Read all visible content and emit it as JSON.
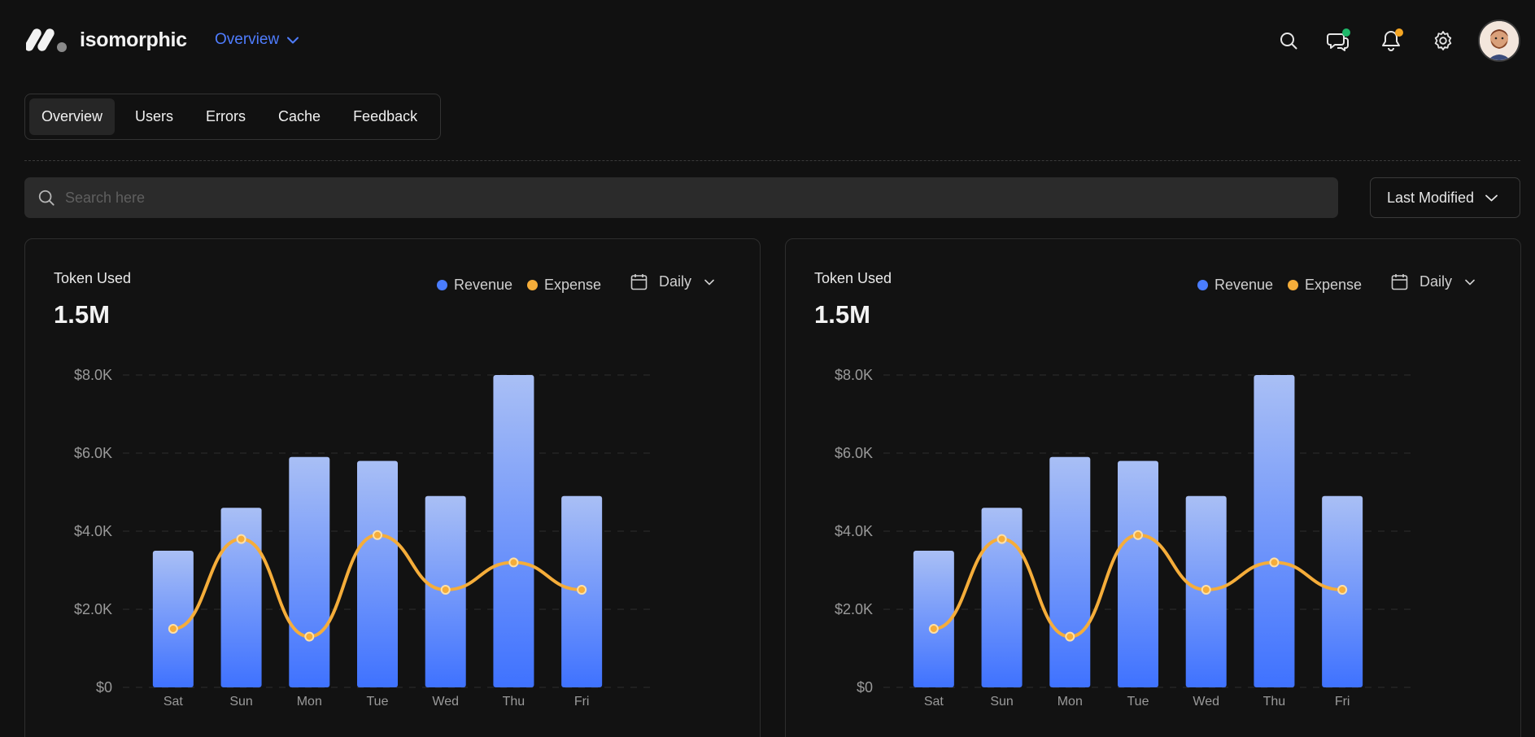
{
  "app": {
    "name": "isomorphic",
    "nav_label": "Overview"
  },
  "header_icons": [
    "search-icon",
    "chat-icon",
    "bell-icon",
    "gear-icon"
  ],
  "colors": {
    "accent": "#4f7dff",
    "revenue": "#4a7dff",
    "expense": "#f5ad3a",
    "chat_dot": "#1fb86a",
    "bell_dot": "#f5a623"
  },
  "tabs": [
    {
      "label": "Overview",
      "active": true
    },
    {
      "label": "Users",
      "active": false
    },
    {
      "label": "Errors",
      "active": false
    },
    {
      "label": "Cache",
      "active": false
    },
    {
      "label": "Feedback",
      "active": false
    }
  ],
  "search": {
    "placeholder": "Search here"
  },
  "sort": {
    "label": "Last Modified"
  },
  "cards": [
    {
      "title": "Token Used",
      "value": "1.5M",
      "legend": {
        "revenue": "Revenue",
        "expense": "Expense"
      },
      "period": "Daily"
    },
    {
      "title": "Token Used",
      "value": "1.5M",
      "legend": {
        "revenue": "Revenue",
        "expense": "Expense"
      },
      "period": "Daily"
    }
  ],
  "chart_data": [
    {
      "type": "bar",
      "categories": [
        "Sat",
        "Sun",
        "Mon",
        "Tue",
        "Wed",
        "Thu",
        "Fri"
      ],
      "series": [
        {
          "name": "Revenue",
          "type": "bar",
          "values": [
            3500,
            4600,
            5900,
            5800,
            4900,
            8000,
            4900
          ]
        },
        {
          "name": "Expense",
          "type": "line",
          "values": [
            1500,
            3800,
            1300,
            3900,
            2500,
            3200,
            2500
          ]
        }
      ],
      "yticks": [
        "$0",
        "$2.0K",
        "$4.0K",
        "$6.0K",
        "$8.0K"
      ],
      "ylim": [
        0,
        8000
      ],
      "grid": true,
      "legend": "top-right"
    },
    {
      "type": "bar",
      "categories": [
        "Sat",
        "Sun",
        "Mon",
        "Tue",
        "Wed",
        "Thu",
        "Fri"
      ],
      "series": [
        {
          "name": "Revenue",
          "type": "bar",
          "values": [
            3500,
            4600,
            5900,
            5800,
            4900,
            8000,
            4900
          ]
        },
        {
          "name": "Expense",
          "type": "line",
          "values": [
            1500,
            3800,
            1300,
            3900,
            2500,
            3200,
            2500
          ]
        }
      ],
      "yticks": [
        "$0",
        "$2.0K",
        "$4.0K",
        "$6.0K",
        "$8.0K"
      ],
      "ylim": [
        0,
        8000
      ],
      "grid": true,
      "legend": "top-right"
    }
  ]
}
